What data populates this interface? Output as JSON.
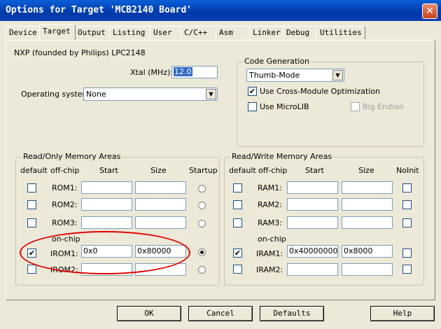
{
  "window": {
    "title": "Options for Target 'MCB2140 Board'",
    "close_glyph": "✕"
  },
  "tabs": [
    {
      "label": "Device"
    },
    {
      "label": "Target"
    },
    {
      "label": "Output"
    },
    {
      "label": "Listing"
    },
    {
      "label": "User"
    },
    {
      "label": "C/C++"
    },
    {
      "label": "Asm"
    },
    {
      "label": "Linker"
    },
    {
      "label": "Debug"
    },
    {
      "label": "Utilities"
    }
  ],
  "active_tab": "Target",
  "target": {
    "device_name": "NXP (founded by Philips) LPC2148",
    "xtal_label": "Xtal (MHz):",
    "xtal_value": "12.0",
    "os_label": "Operating system:",
    "os_value": "None"
  },
  "code_generation": {
    "legend": "Code Generation",
    "mode_value": "Thumb-Mode",
    "cross_module_label": "Use Cross-Module Optimization",
    "cross_module_checked": true,
    "microlib_label": "Use MicroLIB",
    "microlib_checked": false,
    "big_endian_label": "Big Endian",
    "big_endian_checked": false
  },
  "ro_memory": {
    "legend": "Read/Only Memory Areas",
    "headers": {
      "default": "default",
      "offchip": "off-chip",
      "start": "Start",
      "size": "Size",
      "startup": "Startup"
    },
    "onchip_label": "on-chip",
    "rows": [
      {
        "name": "ROM1:",
        "start": "",
        "size": "",
        "default_checked": false,
        "startup_checked": false
      },
      {
        "name": "ROM2:",
        "start": "",
        "size": "",
        "default_checked": false,
        "startup_checked": false
      },
      {
        "name": "ROM3:",
        "start": "",
        "size": "",
        "default_checked": false,
        "startup_checked": false
      },
      {
        "name": "IROM1:",
        "start": "0x0",
        "size": "0x80000",
        "default_checked": true,
        "startup_checked": true
      },
      {
        "name": "IROM2:",
        "start": "",
        "size": "",
        "default_checked": false,
        "startup_checked": false
      }
    ]
  },
  "rw_memory": {
    "legend": "Read/Write Memory Areas",
    "headers": {
      "default": "default",
      "offchip": "off-chip",
      "start": "Start",
      "size": "Size",
      "noinit": "NoInit"
    },
    "onchip_label": "on-chip",
    "rows": [
      {
        "name": "RAM1:",
        "start": "",
        "size": "",
        "default_checked": false,
        "noinit_checked": false
      },
      {
        "name": "RAM2:",
        "start": "",
        "size": "",
        "default_checked": false,
        "noinit_checked": false
      },
      {
        "name": "RAM3:",
        "start": "",
        "size": "",
        "default_checked": false,
        "noinit_checked": false
      },
      {
        "name": "IRAM1:",
        "start": "0x40000000",
        "size": "0x8000",
        "default_checked": true,
        "noinit_checked": false
      },
      {
        "name": "IRAM2:",
        "start": "",
        "size": "",
        "default_checked": false,
        "noinit_checked": false
      }
    ]
  },
  "buttons": {
    "ok": "OK",
    "cancel": "Cancel",
    "defaults": "Defaults",
    "help": "Help"
  },
  "glyphs": {
    "check": "✔",
    "dropdown": "▼"
  },
  "colors": {
    "title_bar": "#0039a8",
    "annotation_ellipse": "#e00000",
    "dialog_bg": "#ece9d8"
  }
}
